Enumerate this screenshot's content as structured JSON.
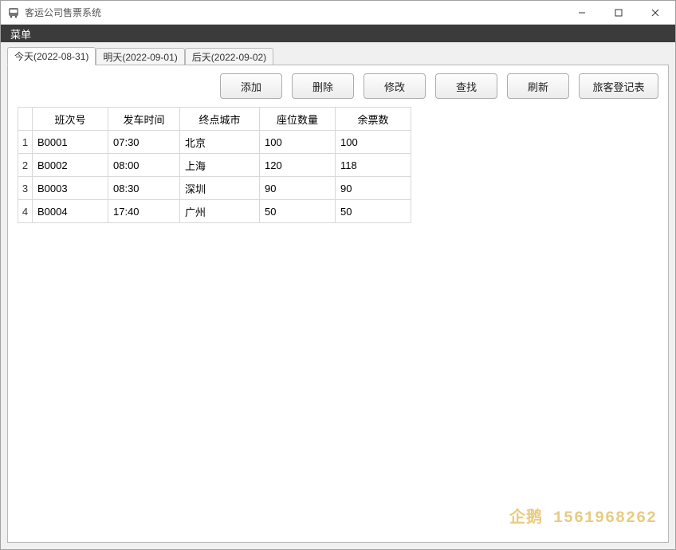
{
  "window": {
    "title": "客运公司售票系统"
  },
  "menu": {
    "label": "菜单"
  },
  "tabs": [
    {
      "label": "今天(2022-08-31)",
      "active": true
    },
    {
      "label": "明天(2022-09-01)",
      "active": false
    },
    {
      "label": "后天(2022-09-02)",
      "active": false
    }
  ],
  "toolbar": {
    "add": "添加",
    "delete": "删除",
    "modify": "修改",
    "search": "查找",
    "refresh": "刷新",
    "passenger": "旅客登记表"
  },
  "table": {
    "headers": {
      "bus_no": "班次号",
      "depart_time": "发车时间",
      "dest_city": "终点城市",
      "seat_count": "座位数量",
      "remaining": "余票数"
    },
    "rows": [
      {
        "idx": "1",
        "bus_no": "B0001",
        "depart_time": "07:30",
        "dest_city": "北京",
        "seat_count": "100",
        "remaining": "100"
      },
      {
        "idx": "2",
        "bus_no": "B0002",
        "depart_time": "08:00",
        "dest_city": "上海",
        "seat_count": "120",
        "remaining": "118"
      },
      {
        "idx": "3",
        "bus_no": "B0003",
        "depart_time": "08:30",
        "dest_city": "深圳",
        "seat_count": "90",
        "remaining": "90"
      },
      {
        "idx": "4",
        "bus_no": "B0004",
        "depart_time": "17:40",
        "dest_city": "广州",
        "seat_count": "50",
        "remaining": "50"
      }
    ]
  },
  "watermark": "企鹅 1561968262"
}
